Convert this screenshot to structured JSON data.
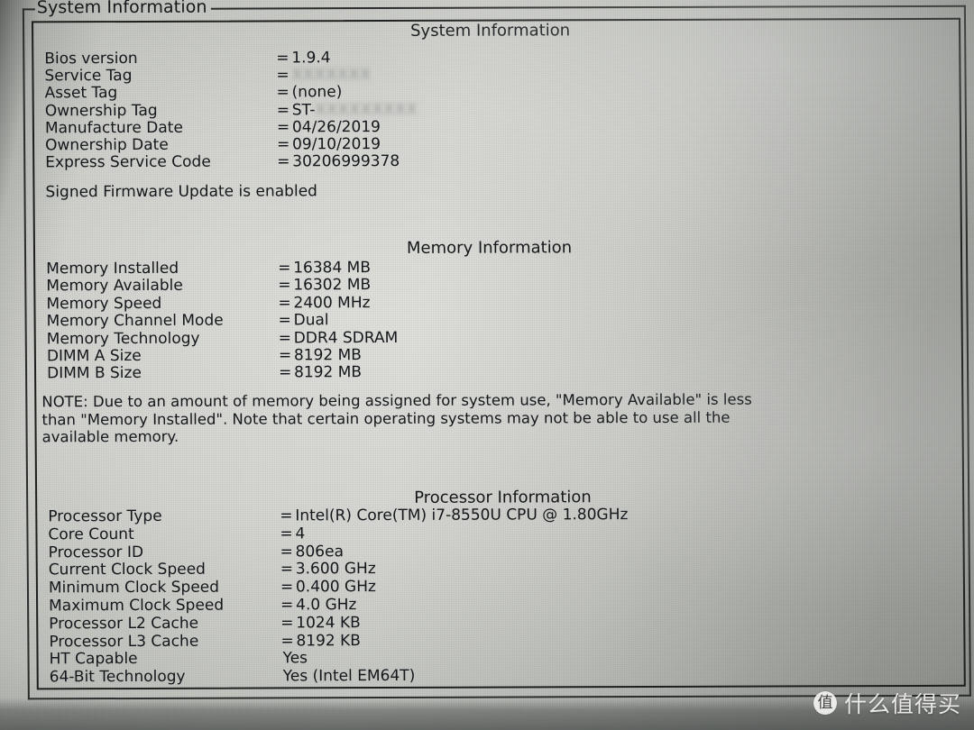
{
  "window": {
    "group_title": "System Information"
  },
  "sections": [
    {
      "id": "system",
      "title": "System Information",
      "rows": [
        {
          "label": "Bios version",
          "eq": "=",
          "value": "1.9.4",
          "redacted": false
        },
        {
          "label": "Service Tag",
          "eq": "=",
          "value": "XXXXXXX",
          "redacted": true
        },
        {
          "label": "Asset Tag",
          "eq": "=",
          "value": "(none)",
          "redacted": false
        },
        {
          "label": "Ownership Tag",
          "eq": "=",
          "value": "ST-",
          "redacted": "partial",
          "redacted_suffix": "XXXXXXXXX"
        },
        {
          "label": "Manufacture Date",
          "eq": "=",
          "value": "04/26/2019",
          "redacted": false
        },
        {
          "label": "Ownership Date",
          "eq": "=",
          "value": "09/10/2019",
          "redacted": false
        },
        {
          "label": "Express Service Code",
          "eq": "=",
          "value": "30206999378",
          "redacted": false
        }
      ],
      "statement": "Signed Firmware Update is enabled"
    },
    {
      "id": "memory",
      "title": "Memory Information",
      "rows": [
        {
          "label": "Memory Installed",
          "eq": "=",
          "value": "16384 MB",
          "redacted": false
        },
        {
          "label": "Memory Available",
          "eq": "=",
          "value": "16302 MB",
          "redacted": false
        },
        {
          "label": "Memory Speed",
          "eq": "=",
          "value": "2400 MHz",
          "redacted": false
        },
        {
          "label": "Memory Channel Mode",
          "eq": "=",
          "value": "Dual",
          "redacted": false
        },
        {
          "label": "Memory Technology",
          "eq": "=",
          "value": "DDR4 SDRAM",
          "redacted": false
        },
        {
          "label": "DIMM A Size",
          "eq": "=",
          "value": "8192 MB",
          "redacted": false
        },
        {
          "label": "DIMM B Size",
          "eq": "=",
          "value": "8192 MB",
          "redacted": false
        }
      ],
      "note": [
        "NOTE: Due to an amount of memory being assigned for system use, \"Memory Available\" is less",
        "than \"Memory Installed\". Note that certain operating systems may not be able to use all the",
        "available memory."
      ]
    },
    {
      "id": "processor",
      "title": "Processor Information",
      "rows": [
        {
          "label": "Processor Type",
          "eq": "=",
          "value": "Intel(R) Core(TM) i7-8550U CPU @ 1.80GHz",
          "redacted": false
        },
        {
          "label": "Core Count",
          "eq": "=",
          "value": "4",
          "redacted": false
        },
        {
          "label": "Processor ID",
          "eq": "=",
          "value": "806ea",
          "redacted": false
        },
        {
          "label": "Current Clock Speed",
          "eq": "=",
          "value": "3.600 GHz",
          "redacted": false
        },
        {
          "label": "Minimum Clock Speed",
          "eq": "=",
          "value": "0.400 GHz",
          "redacted": false
        },
        {
          "label": "Maximum Clock Speed",
          "eq": "=",
          "value": "4.0 GHz",
          "redacted": false
        },
        {
          "label": "Processor L2 Cache",
          "eq": "=",
          "value": "1024 KB",
          "redacted": false
        },
        {
          "label": "Processor L3 Cache",
          "eq": "=",
          "value": "8192 KB",
          "redacted": false
        },
        {
          "label": "HT Capable",
          "eq": "",
          "value": "Yes",
          "redacted": false
        },
        {
          "label": "64-Bit Technology",
          "eq": "",
          "value": "Yes (Intel EM64T)",
          "redacted": false
        }
      ]
    }
  ],
  "watermark": {
    "logo_glyph": "值",
    "text": "什么值得买"
  },
  "colors": {
    "panel_bg": "#d6d7d2",
    "text": "#14171b",
    "border": "#1d201e"
  }
}
